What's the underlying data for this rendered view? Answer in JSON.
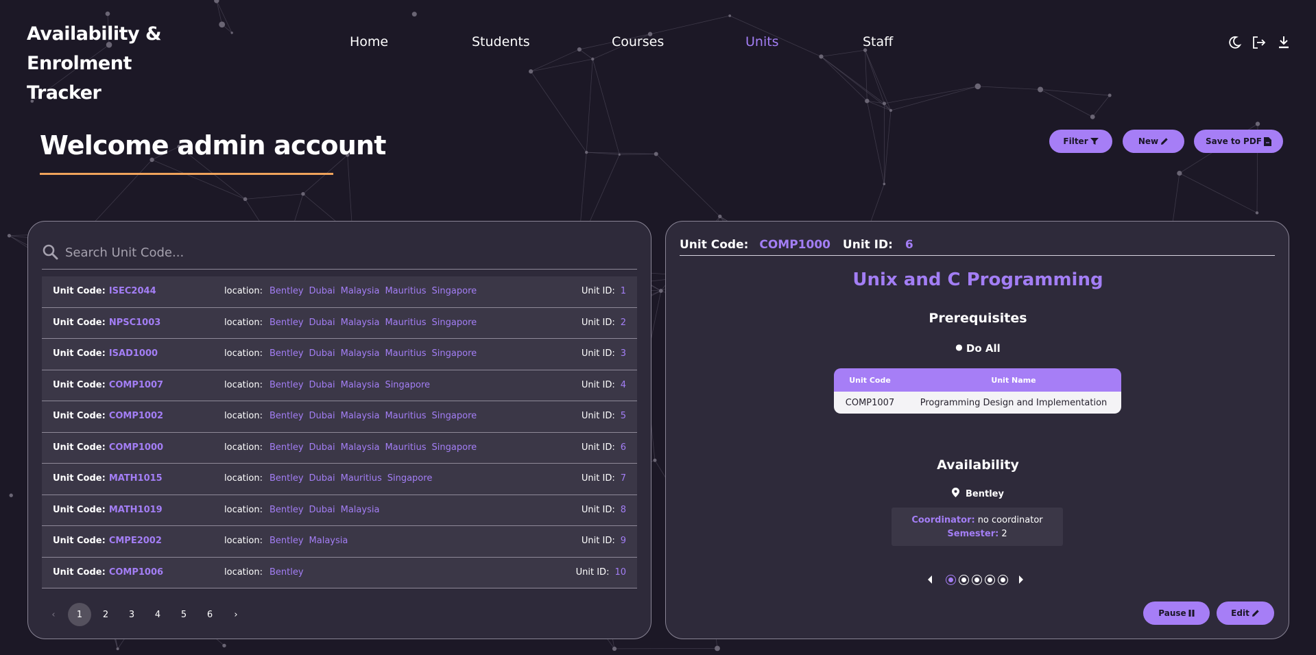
{
  "app": {
    "title_lines": [
      "Availability &",
      "Enrolment",
      "Tracker"
    ]
  },
  "nav": [
    {
      "label": "Home",
      "active": false
    },
    {
      "label": "Students",
      "active": false
    },
    {
      "label": "Courses",
      "active": false
    },
    {
      "label": "Units",
      "active": true
    },
    {
      "label": "Staff",
      "active": false
    }
  ],
  "top_icons": [
    "moon-icon",
    "logout-icon",
    "download-icon"
  ],
  "welcome": "Welcome admin account",
  "actions": {
    "filter_label": "Filter",
    "new_label": "New",
    "save_pdf_label": "Save to PDF"
  },
  "search": {
    "placeholder": "Search Unit Code...",
    "value": ""
  },
  "list_labels": {
    "unit_code": "Unit Code:",
    "location": "location:",
    "unit_id": "Unit ID:"
  },
  "units": [
    {
      "code": "ISEC2044",
      "locations": [
        "Bentley",
        "Dubai",
        "Malaysia",
        "Mauritius",
        "Singapore"
      ],
      "id": "1"
    },
    {
      "code": "NPSC1003",
      "locations": [
        "Bentley",
        "Dubai",
        "Malaysia",
        "Mauritius",
        "Singapore"
      ],
      "id": "2"
    },
    {
      "code": "ISAD1000",
      "locations": [
        "Bentley",
        "Dubai",
        "Malaysia",
        "Mauritius",
        "Singapore"
      ],
      "id": "3"
    },
    {
      "code": "COMP1007",
      "locations": [
        "Bentley",
        "Dubai",
        "Malaysia",
        "Singapore"
      ],
      "id": "4"
    },
    {
      "code": "COMP1002",
      "locations": [
        "Bentley",
        "Dubai",
        "Malaysia",
        "Mauritius",
        "Singapore"
      ],
      "id": "5"
    },
    {
      "code": "COMP1000",
      "locations": [
        "Bentley",
        "Dubai",
        "Malaysia",
        "Mauritius",
        "Singapore"
      ],
      "id": "6"
    },
    {
      "code": "MATH1015",
      "locations": [
        "Bentley",
        "Dubai",
        "Mauritius",
        "Singapore"
      ],
      "id": "7"
    },
    {
      "code": "MATH1019",
      "locations": [
        "Bentley",
        "Dubai",
        "Malaysia"
      ],
      "id": "8"
    },
    {
      "code": "CMPE2002",
      "locations": [
        "Bentley",
        "Malaysia"
      ],
      "id": "9"
    },
    {
      "code": "COMP1006",
      "locations": [
        "Bentley"
      ],
      "id": "10"
    }
  ],
  "pagination": {
    "prev": "‹",
    "pages": [
      "1",
      "2",
      "3",
      "4",
      "5",
      "6"
    ],
    "current": "1",
    "next": "›"
  },
  "detail": {
    "code_label": "Unit Code:",
    "code": "COMP1000",
    "id_label": "Unit ID:",
    "id": "6",
    "title": "Unix and C Programming",
    "prereq_heading": "Prerequisites",
    "prereq_rule": "Do All",
    "prereq_columns": [
      "Unit Code",
      "Unit Name"
    ],
    "prereq_rows": [
      {
        "code": "COMP1007",
        "name": "Programming Design and Implementation"
      }
    ],
    "availability_heading": "Availability",
    "campus": "Bentley",
    "coordinator_label": "Coordinator:",
    "coordinator": "no coordinator",
    "semester_label": "Semester:",
    "semester": "2",
    "carousel_count": 5,
    "carousel_active_index": 0,
    "pause_label": "Pause",
    "edit_label": "Edit"
  },
  "colors": {
    "background": "#1c1826",
    "panel": "#2e2a3a",
    "accent": "#a37ef5",
    "underline": "#f0a35b"
  }
}
